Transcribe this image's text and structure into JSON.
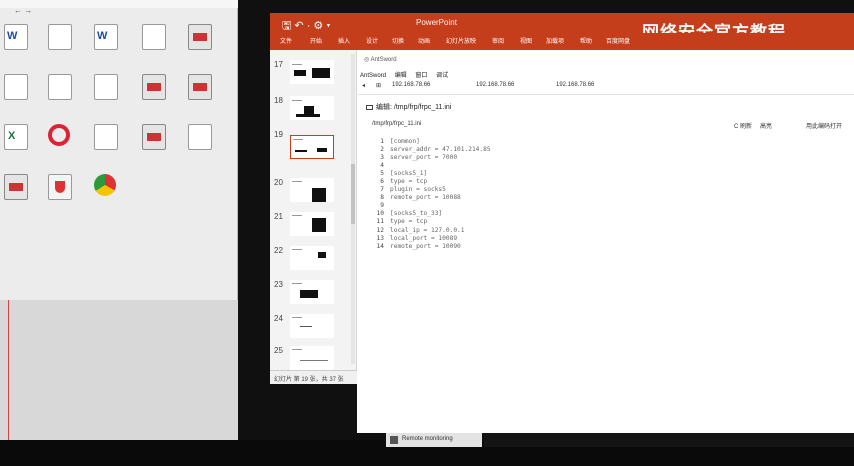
{
  "desktop": {
    "title": "← →",
    "icons": [
      {
        "caption": "",
        "kind": "word"
      },
      {
        "caption": "",
        "kind": "doc"
      },
      {
        "caption": "",
        "kind": "word"
      },
      {
        "caption": "",
        "kind": "doc"
      },
      {
        "caption": "",
        "kind": "tool"
      },
      {
        "caption": "",
        "kind": "doc"
      },
      {
        "caption": "",
        "kind": "doc"
      },
      {
        "caption": "",
        "kind": "doc"
      },
      {
        "caption": "",
        "kind": "tool"
      },
      {
        "caption": "",
        "kind": "tool"
      },
      {
        "caption": "",
        "kind": "excel"
      },
      {
        "caption": "",
        "kind": "ring"
      },
      {
        "caption": "",
        "kind": "doc"
      },
      {
        "caption": "",
        "kind": "tool"
      },
      {
        "caption": "",
        "kind": "doc"
      },
      {
        "caption": "",
        "kind": "tool"
      },
      {
        "caption": "",
        "kind": "shield"
      },
      {
        "caption": "",
        "kind": "chrome"
      }
    ]
  },
  "ppt": {
    "quick_access": "🖫 ↶ · ⚙ ▾",
    "title": "PowerPoint",
    "tabs": [
      "文件",
      "开始",
      "插入",
      "设计",
      "切换",
      "动画",
      "幻灯片放映",
      "审阅",
      "视图",
      "加载项",
      "帮助",
      "百度网盘"
    ],
    "watermark": "网络安全官方教程",
    "slide_numbers": [
      "17",
      "18",
      "19",
      "20",
      "21",
      "22",
      "23",
      "24",
      "25"
    ],
    "status": "幻灯片 第 19 张，共 37 张"
  },
  "slide": {
    "app_title": "AntSword",
    "menu": [
      "AntSword",
      "编辑",
      "窗口",
      "调试"
    ],
    "tabs": [
      "192.168.78.66",
      "192.168.78.66",
      "192.168.78.66"
    ],
    "dir_label": "编辑: /tmp/frp/frpc_11.ini",
    "path": "/tmp/frp/frpc_11.ini",
    "tool_refresh": "C 刷新",
    "tool_highlight": "高亮",
    "tool_encoding": "用此编码打开",
    "code_lines": [
      {
        "n": "1",
        "t": "[common]"
      },
      {
        "n": "2",
        "t": "server_addr = 47.101.214.85"
      },
      {
        "n": "3",
        "t": "server_port = 7000"
      },
      {
        "n": "4",
        "t": ""
      },
      {
        "n": "5",
        "t": "[socks5_1]"
      },
      {
        "n": "6",
        "t": "type = tcp"
      },
      {
        "n": "7",
        "t": "plugin = socks5"
      },
      {
        "n": "8",
        "t": "remote_port = 10088"
      },
      {
        "n": "9",
        "t": ""
      },
      {
        "n": "10",
        "t": "[socks5_to_33]"
      },
      {
        "n": "11",
        "t": "type = tcp"
      },
      {
        "n": "12",
        "t": "local_ip = 127.0.0.1"
      },
      {
        "n": "13",
        "t": "local_port = 10089"
      },
      {
        "n": "14",
        "t": "remote_port = 10090"
      }
    ]
  },
  "taskbar": {
    "notification": "Remote monitoring"
  }
}
